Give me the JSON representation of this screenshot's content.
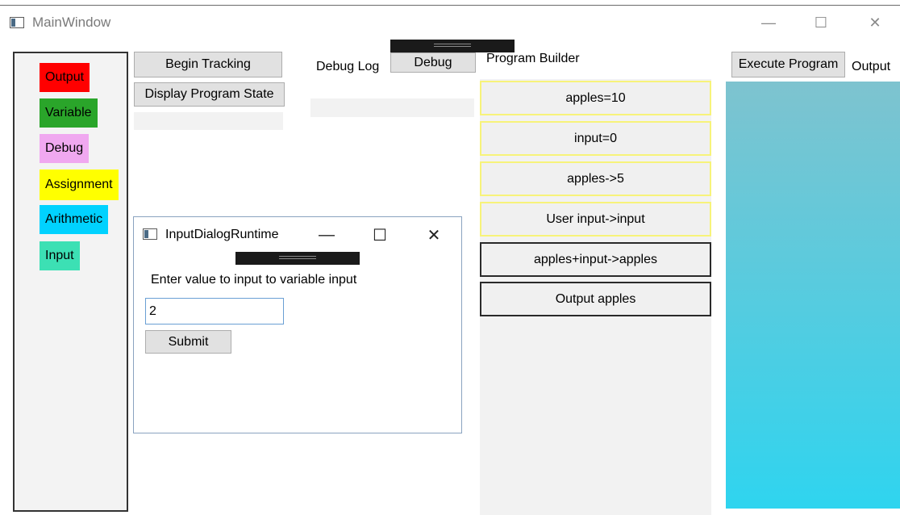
{
  "window": {
    "title": "MainWindow",
    "controls": {
      "minimize": "—",
      "maximize": "☐",
      "close": "✕"
    }
  },
  "palette": {
    "items": [
      {
        "label": "Output",
        "color": "#ff0000"
      },
      {
        "label": "Variable",
        "color": "#2aa52a"
      },
      {
        "label": "Debug",
        "color": "#f0a8f0"
      },
      {
        "label": "Assignment",
        "color": "#ffff00"
      },
      {
        "label": "Arithmetic",
        "color": "#00d2ff"
      },
      {
        "label": "Input",
        "color": "#3ce0b4"
      }
    ]
  },
  "tracking": {
    "begin_label": "Begin Tracking",
    "display_state_label": "Display Program State"
  },
  "debug": {
    "log_label": "Debug Log",
    "button_label": "Debug"
  },
  "program_builder": {
    "label": "Program Builder",
    "items": [
      {
        "text": "apples=10",
        "style": "yellow"
      },
      {
        "text": "input=0",
        "style": "yellow"
      },
      {
        "text": "apples->5",
        "style": "yellow"
      },
      {
        "text": "User input->input",
        "style": "yellow"
      },
      {
        "text": "apples+input->apples",
        "style": "dark"
      },
      {
        "text": "Output apples",
        "style": "dark"
      }
    ]
  },
  "output": {
    "execute_label": "Execute Program",
    "label": "Output"
  },
  "dialog": {
    "title": "InputDialogRuntime",
    "controls": {
      "minimize": "—",
      "maximize": "☐",
      "close": "✕"
    },
    "prompt": "Enter value to input to variable input",
    "input_value": "2",
    "submit_label": "Submit"
  }
}
